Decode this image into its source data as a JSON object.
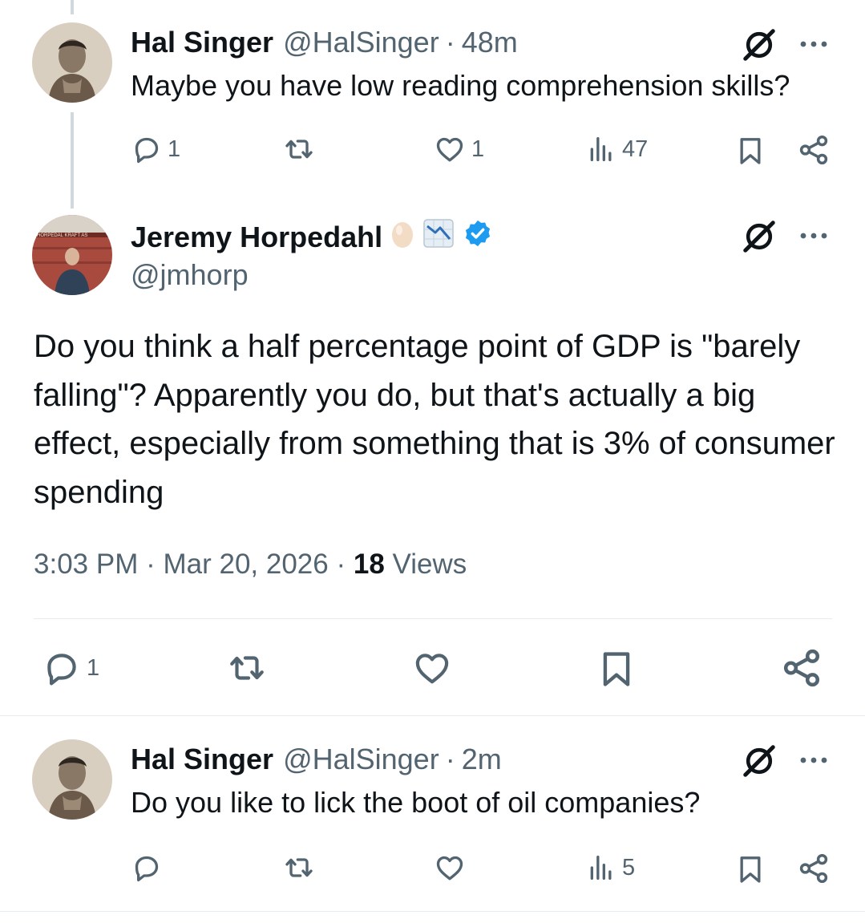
{
  "tweets": [
    {
      "name": "Hal Singer",
      "handle": "@HalSinger",
      "sep": "·",
      "time": "48m",
      "text": "Maybe you have low reading comprehension skills?",
      "replies": "1",
      "likes": "1",
      "views": "47"
    },
    {
      "name": "Jeremy Horpedahl",
      "handle": "@jmhorp",
      "badges": [
        "egg-emoji",
        "chart-decreasing-emoji",
        "verified-badge"
      ],
      "text": "Do you think a half percentage point of GDP is \"barely falling\"? Apparently you do, but that's actually a big effect, especially from something that is 3% of consumer spending",
      "time": "3:03 PM",
      "sep": "·",
      "date": "Mar 20, 2026",
      "views_count": "18",
      "views_label": "Views",
      "replies": "1",
      "avatar_sign": "HORPEDAL KRAFT AS"
    },
    {
      "name": "Hal Singer",
      "handle": "@HalSinger",
      "sep": "·",
      "time": "2m",
      "text": "Do you like to lick the boot of oil companies?",
      "views": "5"
    }
  ],
  "colors": {
    "text": "#0f1419",
    "secondary": "#536471",
    "verified": "#1d9bf0",
    "divider": "#e6ecf0",
    "thread": "#cfd9de"
  },
  "icons": [
    "reply-icon",
    "retweet-icon",
    "like-icon",
    "views-icon",
    "bookmark-icon",
    "share-icon",
    "grok-icon",
    "more-icon"
  ]
}
